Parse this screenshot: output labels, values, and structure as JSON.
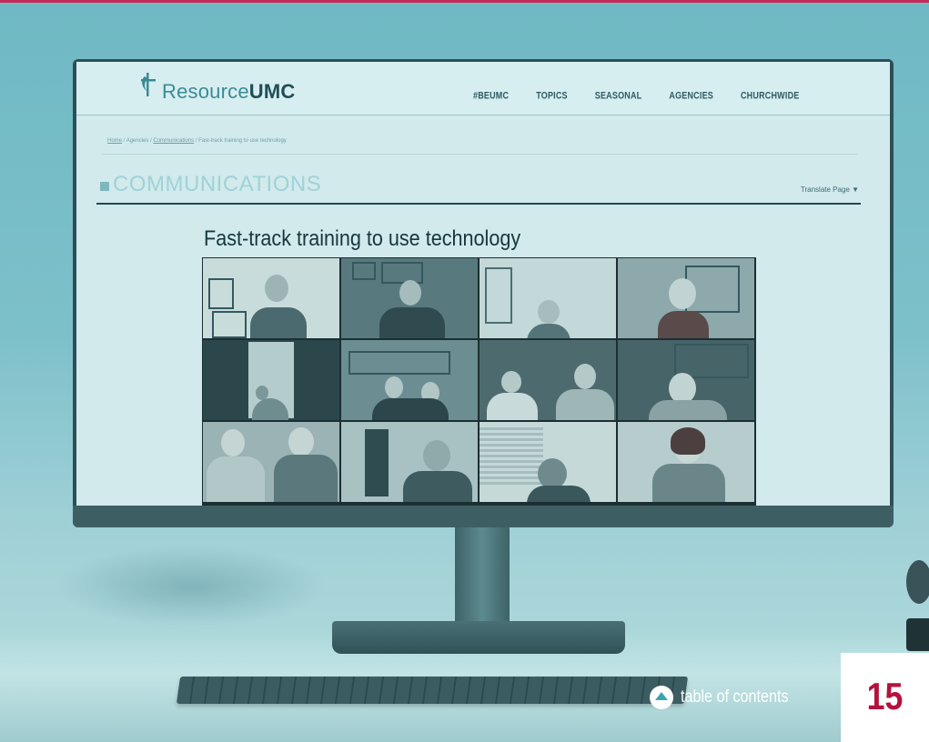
{
  "site": {
    "logo_prefix": "Resource",
    "logo_suffix": "UMC",
    "nav": [
      "#BEUMC",
      "TOPICS",
      "SEASONAL",
      "AGENCIES",
      "CHURCHWIDE"
    ]
  },
  "breadcrumb": {
    "home": "Home",
    "sep1": " / ",
    "agencies": "Agencies",
    "sep2": " / ",
    "communications": "Communications",
    "sep3": " / ",
    "current": "Fast-track training to use technology"
  },
  "section": {
    "title": "COMMUNICATIONS",
    "translate": "Translate Page ▼"
  },
  "article": {
    "title": "Fast-track training to use technology"
  },
  "footer": {
    "toc_label": "table of contents",
    "page_number": "15"
  },
  "colors": {
    "accent": "#b4123e",
    "tint": "#6fb9c4"
  },
  "icons": [
    "cross-flame-logo-icon",
    "caret-up-icon"
  ]
}
